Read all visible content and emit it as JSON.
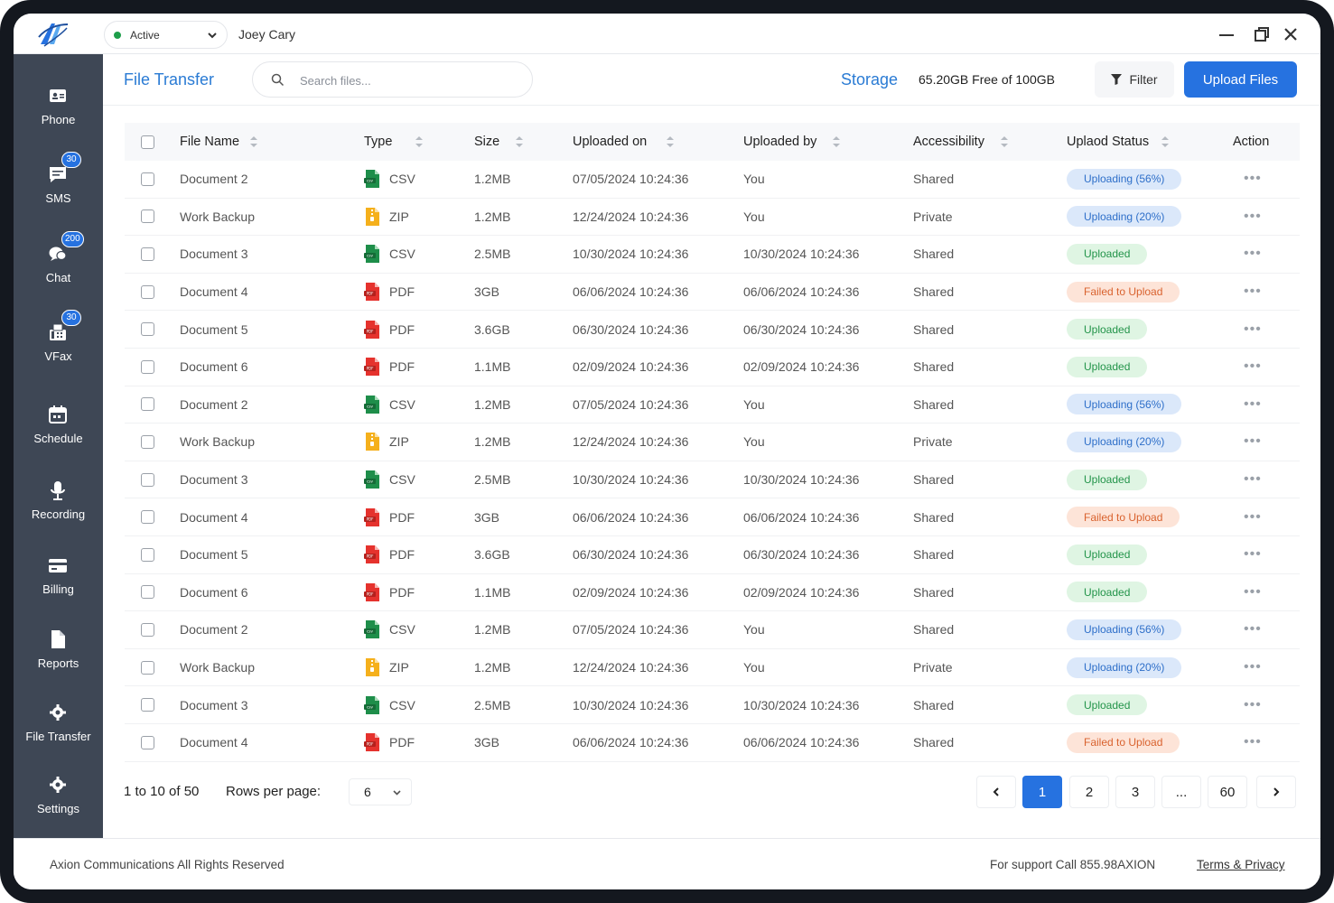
{
  "colors": {
    "accent": "#2672e0",
    "sidebar": "#3e4755",
    "title_blue": "#2a7bd4",
    "status_active": "#1e9e4a"
  },
  "topbar": {
    "status": "Active",
    "username": "Joey Cary"
  },
  "sidebar": {
    "items": [
      {
        "label": "Phone",
        "icon": "phone-icon"
      },
      {
        "label": "SMS",
        "icon": "sms-icon",
        "badge": "30"
      },
      {
        "label": "Chat",
        "icon": "chat-icon",
        "badge": "200"
      },
      {
        "label": "VFax",
        "icon": "fax-icon",
        "badge": "30"
      },
      {
        "label": "Schedule",
        "icon": "calendar-icon"
      },
      {
        "label": "Recording",
        "icon": "microphone-icon"
      },
      {
        "label": "Billing",
        "icon": "credit-card-icon"
      },
      {
        "label": "Reports",
        "icon": "document-icon"
      },
      {
        "label": "File Transfer",
        "icon": "gear-icon"
      },
      {
        "label": "Settings",
        "icon": "gear-icon"
      }
    ]
  },
  "header": {
    "title": "File Transfer",
    "search_placeholder": "Search files...",
    "storage_label": "Storage",
    "storage_value": "65.20GB Free of 100GB",
    "filter_label": "Filter",
    "upload_label": "Upload Files"
  },
  "table": {
    "columns": [
      "File Name",
      "Type",
      "Size",
      "Uploaded on",
      "Uploaded by",
      "Accessibility",
      "Uplaod Status",
      "Action"
    ],
    "rows": [
      {
        "name": "Document 2",
        "type": "CSV",
        "size": "1.2MB",
        "uploaded_on": "07/05/2024 10:24:36",
        "uploaded_by": "You",
        "access": "Shared",
        "status": "Uploading (56%)",
        "status_kind": "uploading"
      },
      {
        "name": "Work Backup",
        "type": "ZIP",
        "size": "1.2MB",
        "uploaded_on": "12/24/2024 10:24:36",
        "uploaded_by": "You",
        "access": "Private",
        "status": "Uploading (20%)",
        "status_kind": "uploading"
      },
      {
        "name": "Document 3",
        "type": "CSV",
        "size": "2.5MB",
        "uploaded_on": "10/30/2024 10:24:36",
        "uploaded_by": "10/30/2024 10:24:36",
        "access": "Shared",
        "status": "Uploaded",
        "status_kind": "uploaded"
      },
      {
        "name": "Document 4",
        "type": "PDF",
        "size": "3GB",
        "uploaded_on": "06/06/2024 10:24:36",
        "uploaded_by": "06/06/2024 10:24:36",
        "access": "Shared",
        "status": "Failed to Upload",
        "status_kind": "failed"
      },
      {
        "name": "Document 5",
        "type": "PDF",
        "size": "3.6GB",
        "uploaded_on": "06/30/2024 10:24:36",
        "uploaded_by": "06/30/2024 10:24:36",
        "access": "Shared",
        "status": "Uploaded",
        "status_kind": "uploaded"
      },
      {
        "name": "Document 6",
        "type": "PDF",
        "size": "1.1MB",
        "uploaded_on": "02/09/2024 10:24:36",
        "uploaded_by": "02/09/2024 10:24:36",
        "access": "Shared",
        "status": "Uploaded",
        "status_kind": "uploaded"
      },
      {
        "name": "Document 2",
        "type": "CSV",
        "size": "1.2MB",
        "uploaded_on": "07/05/2024 10:24:36",
        "uploaded_by": "You",
        "access": "Shared",
        "status": "Uploading (56%)",
        "status_kind": "uploading"
      },
      {
        "name": "Work Backup",
        "type": "ZIP",
        "size": "1.2MB",
        "uploaded_on": "12/24/2024 10:24:36",
        "uploaded_by": "You",
        "access": "Private",
        "status": "Uploading (20%)",
        "status_kind": "uploading"
      },
      {
        "name": "Document 3",
        "type": "CSV",
        "size": "2.5MB",
        "uploaded_on": "10/30/2024 10:24:36",
        "uploaded_by": "10/30/2024 10:24:36",
        "access": "Shared",
        "status": "Uploaded",
        "status_kind": "uploaded"
      },
      {
        "name": "Document 4",
        "type": "PDF",
        "size": "3GB",
        "uploaded_on": "06/06/2024 10:24:36",
        "uploaded_by": "06/06/2024 10:24:36",
        "access": "Shared",
        "status": "Failed to Upload",
        "status_kind": "failed"
      },
      {
        "name": "Document 5",
        "type": "PDF",
        "size": "3.6GB",
        "uploaded_on": "06/30/2024 10:24:36",
        "uploaded_by": "06/30/2024 10:24:36",
        "access": "Shared",
        "status": "Uploaded",
        "status_kind": "uploaded"
      },
      {
        "name": "Document 6",
        "type": "PDF",
        "size": "1.1MB",
        "uploaded_on": "02/09/2024 10:24:36",
        "uploaded_by": "02/09/2024 10:24:36",
        "access": "Shared",
        "status": "Uploaded",
        "status_kind": "uploaded"
      },
      {
        "name": "Document 2",
        "type": "CSV",
        "size": "1.2MB",
        "uploaded_on": "07/05/2024 10:24:36",
        "uploaded_by": "You",
        "access": "Shared",
        "status": "Uploading (56%)",
        "status_kind": "uploading"
      },
      {
        "name": "Work Backup",
        "type": "ZIP",
        "size": "1.2MB",
        "uploaded_on": "12/24/2024 10:24:36",
        "uploaded_by": "You",
        "access": "Private",
        "status": "Uploading (20%)",
        "status_kind": "uploading"
      },
      {
        "name": "Document 3",
        "type": "CSV",
        "size": "2.5MB",
        "uploaded_on": "10/30/2024 10:24:36",
        "uploaded_by": "10/30/2024 10:24:36",
        "access": "Shared",
        "status": "Uploaded",
        "status_kind": "uploaded"
      },
      {
        "name": "Document 4",
        "type": "PDF",
        "size": "3GB",
        "uploaded_on": "06/06/2024 10:24:36",
        "uploaded_by": "06/06/2024 10:24:36",
        "access": "Shared",
        "status": "Failed to Upload",
        "status_kind": "failed"
      }
    ]
  },
  "pagination": {
    "range_text": "1 to 10 of 50",
    "rows_per_page_label": "Rows per page:",
    "rows_per_page": "6",
    "pages": [
      "1",
      "2",
      "3",
      "...",
      "60"
    ],
    "current_page": "1"
  },
  "footer": {
    "copyright": "Axion Communications All Rights Reserved",
    "support": "For support Call 855.98AXION",
    "terms": "Terms & Privacy"
  }
}
